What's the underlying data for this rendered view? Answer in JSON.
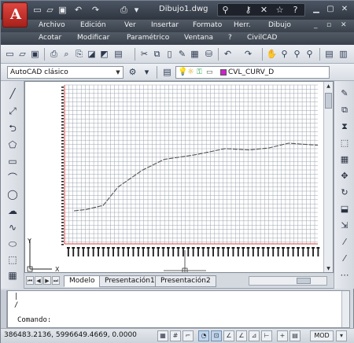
{
  "window": {
    "title": "Dibujo1.dwg",
    "app_button": "A"
  },
  "quick_access": {
    "icons": [
      "new-icon",
      "open-icon",
      "save-icon",
      "undo-icon",
      "redo-icon",
      "plot-icon",
      "dropdown-icon"
    ],
    "help_icons": [
      "binoculars-icon",
      "key-icon",
      "exchange-icon",
      "star-icon",
      "help-icon"
    ]
  },
  "menu_row1": [
    "Archivo",
    "Edición",
    "Ver",
    "Insertar",
    "Formato",
    "Herr.",
    "Dibujo"
  ],
  "menu_row2": [
    "Acotar",
    "Modificar",
    "Paramétrico",
    "Ventana",
    "?",
    "CivilCAD"
  ],
  "toolbar2": {
    "workspace": "AutoCAD clásico",
    "layer": "CVL_CURV_D",
    "layer_color": "#cc22cc"
  },
  "tabs": [
    "Modelo",
    "Presentación1",
    "Presentación2"
  ],
  "command": {
    "lines": [
      "|",
      "/"
    ],
    "prompt": "Comando:"
  },
  "status": {
    "coordinates": "386483.2136, 5996649.4669, 0.0000",
    "model_label": "MOD"
  },
  "colors": {
    "grid": "#9aa3ad",
    "profile_line": "#555555",
    "red_axis": "#e04040",
    "accent": "#a7201b"
  },
  "profile": {
    "points": [
      [
        0,
        0
      ],
      [
        5,
        0.02
      ],
      [
        12,
        0.08
      ],
      [
        18,
        0.35
      ],
      [
        28,
        0.6
      ],
      [
        37,
        0.76
      ],
      [
        50,
        0.83
      ],
      [
        62,
        0.92
      ],
      [
        72,
        0.9
      ],
      [
        80,
        0.93
      ],
      [
        88,
        1.0
      ],
      [
        100,
        0.97
      ]
    ]
  }
}
